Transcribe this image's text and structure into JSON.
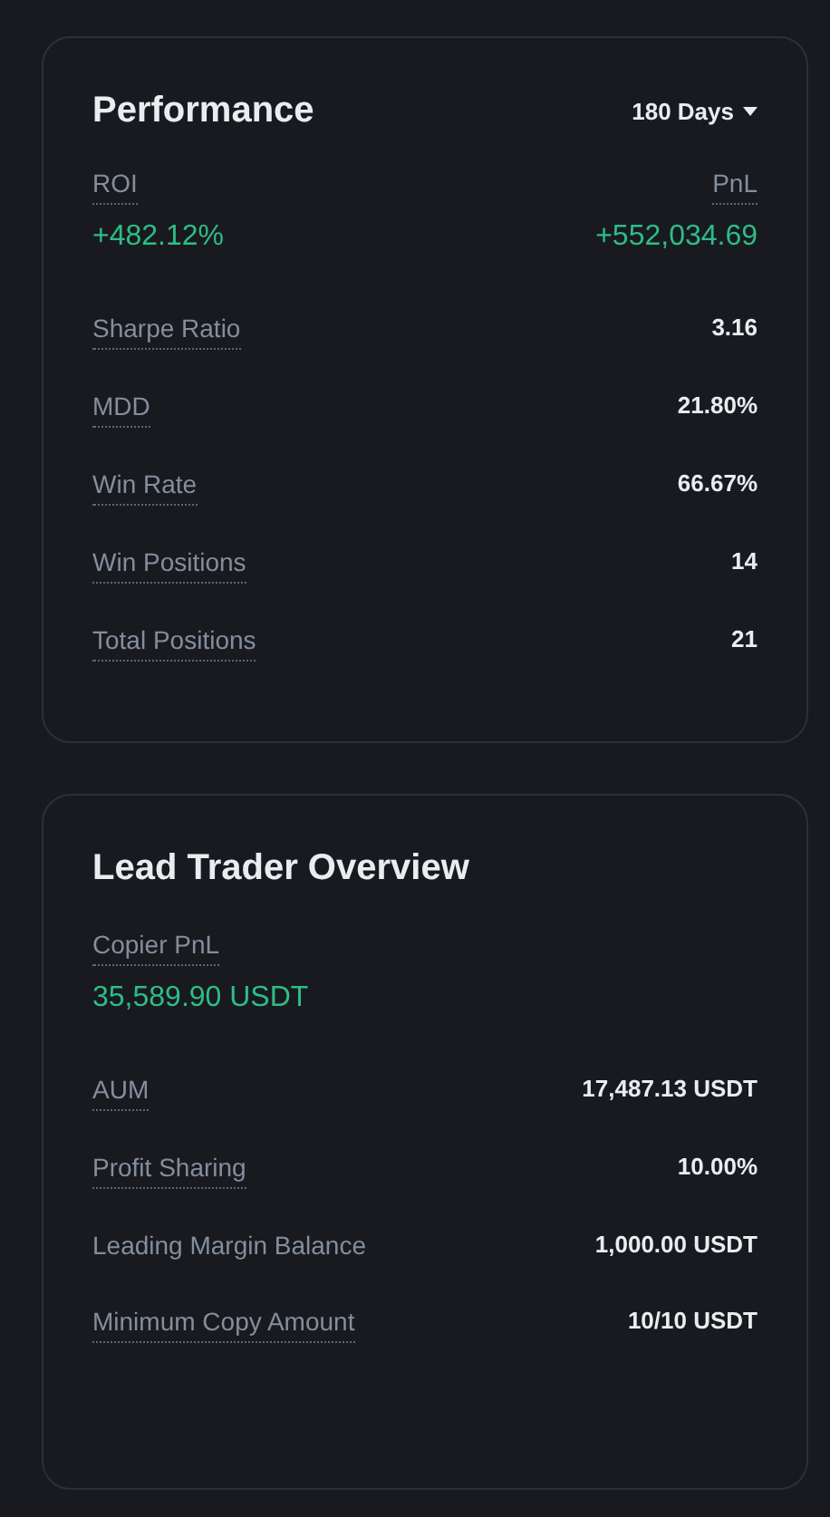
{
  "performance": {
    "title": "Performance",
    "period": "180 Days",
    "highlights": [
      {
        "label": "ROI",
        "value": "+482.12%",
        "underlined": true
      },
      {
        "label": "PnL",
        "value": "+552,034.69",
        "underlined": true
      }
    ],
    "rows": [
      {
        "label": "Sharpe Ratio",
        "value": "3.16",
        "underlined": true
      },
      {
        "label": "MDD",
        "value": "21.80%",
        "underlined": true
      },
      {
        "label": "Win Rate",
        "value": "66.67%",
        "underlined": true
      },
      {
        "label": "Win Positions",
        "value": "14",
        "underlined": true
      },
      {
        "label": "Total Positions",
        "value": "21",
        "underlined": true
      }
    ]
  },
  "overview": {
    "title": "Lead Trader Overview",
    "highlight": {
      "label": "Copier PnL",
      "value": "35,589.90 USDT",
      "underlined": true
    },
    "rows": [
      {
        "label": "AUM",
        "value": "17,487.13 USDT",
        "underlined": true
      },
      {
        "label": "Profit Sharing",
        "value": "10.00%",
        "underlined": true
      },
      {
        "label": "Leading Margin Balance",
        "value": "1,000.00 USDT",
        "underlined": false
      },
      {
        "label": "Minimum Copy Amount",
        "value": "10/10 USDT",
        "underlined": true
      }
    ]
  }
}
